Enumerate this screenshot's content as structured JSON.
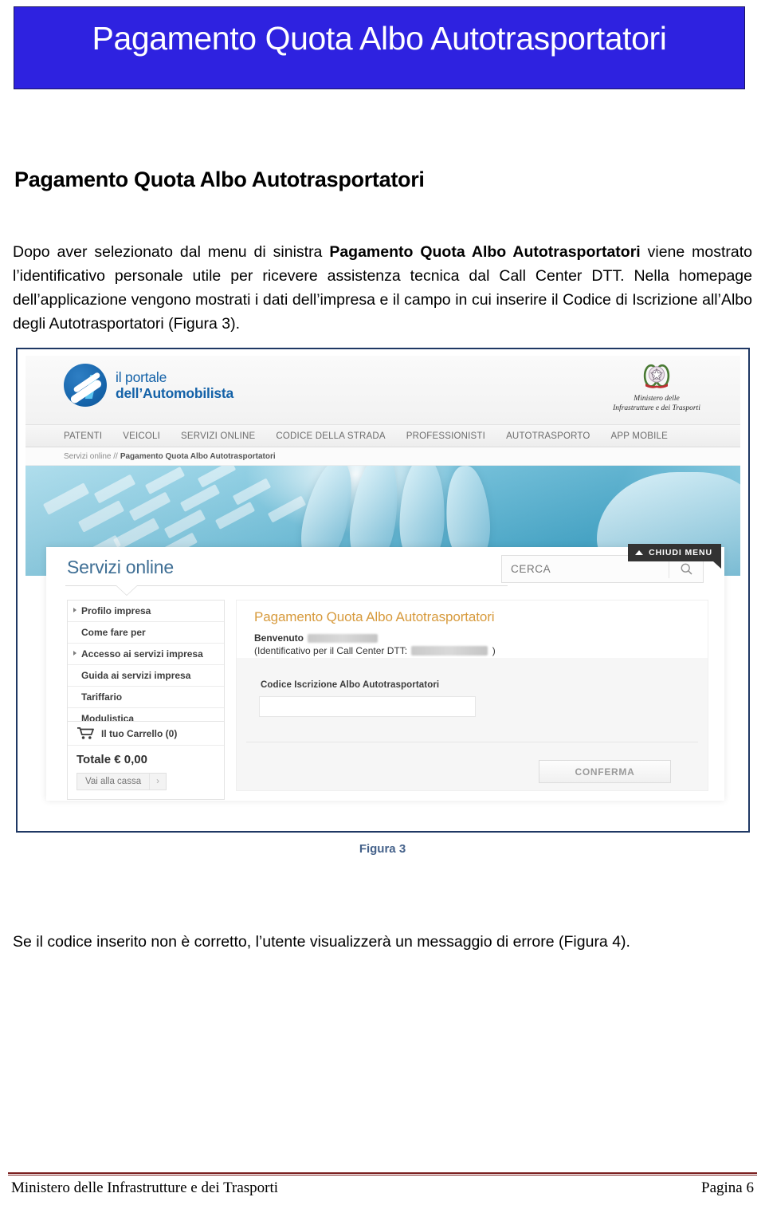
{
  "banner": {
    "title": "Pagamento Quota Albo Autotrasportatori"
  },
  "document": {
    "heading": "Pagamento Quota Albo Autotrasportatori",
    "intro_part1": "Dopo aver selezionato dal menu di sinistra ",
    "intro_bold": "Pagamento Quota Albo Autotrasportatori",
    "intro_part2": " viene mostrato l’identificativo personale utile per ricevere assistenza tecnica dal Call Center DTT. Nella homepage dell’applicazione vengono mostrati i dati dell’impresa e il campo in cui inserire il Codice di Iscrizione all’Albo degli Autotrasportatori (Figura 3).",
    "figure_caption": "Figura 3",
    "error_para": "Se il codice inserito non è corretto, l’utente visualizzerà un messaggio di errore (Figura 4)."
  },
  "screenshot": {
    "logo": {
      "line1": "il portale",
      "line2": "dell’Automobilista"
    },
    "emblem": {
      "caption_line1": "Ministero delle",
      "caption_line2": "Infrastrutture e dei Trasporti"
    },
    "nav": [
      {
        "label": "PATENTI"
      },
      {
        "label": "VEICOLI"
      },
      {
        "label": "SERVIZI ONLINE"
      },
      {
        "label": "CODICE DELLA STRADA"
      },
      {
        "label": "PROFESSIONISTI"
      },
      {
        "label": "AUTOTRASPORTO"
      },
      {
        "label": "APP MOBILE"
      }
    ],
    "breadcrumb": {
      "root": "Servizi online //",
      "current": "Pagamento Quota Albo Autotrasportatori"
    },
    "chiudi_menu": "CHIUDI MENU",
    "section_title": "Servizi online",
    "search": {
      "placeholder": "CERCA",
      "icon": "search-icon"
    },
    "sidebar": [
      {
        "label": "Profilo impresa",
        "has_arrow": true
      },
      {
        "label": "Come fare per",
        "has_arrow": false
      },
      {
        "label": "Accesso ai servizi impresa",
        "has_arrow": true
      },
      {
        "label": "Guida ai servizi impresa",
        "has_arrow": false
      },
      {
        "label": "Tariffario",
        "has_arrow": false
      },
      {
        "label": "Modulistica",
        "has_arrow": false
      }
    ],
    "cart": {
      "label": "Il tuo Carrello (0)",
      "total": "Totale € 0,00",
      "checkout_label": "Vai alla cassa",
      "checkout_arrow": "›"
    },
    "form": {
      "title": "Pagamento Quota Albo Autotrasportatori",
      "welcome_label": "Benvenuto",
      "welcome_name_redacted": "",
      "identifier_prefix": "(Identificativo per il Call Center DTT:",
      "identifier_suffix": ")",
      "field_label": "Codice Iscrizione Albo Autotrasportatori",
      "field_value": "",
      "submit_label": "CONFERMA"
    }
  },
  "footer": {
    "left": "Ministero delle Infrastrutture e dei Trasporti",
    "right": "Pagina 6"
  },
  "colors": {
    "banner_blue": "#2e22e0",
    "caption_blue": "#44618a",
    "footer_red": "#7b2020",
    "form_title_orange": "#d79a3c",
    "portal_blue": "#1462a8"
  }
}
